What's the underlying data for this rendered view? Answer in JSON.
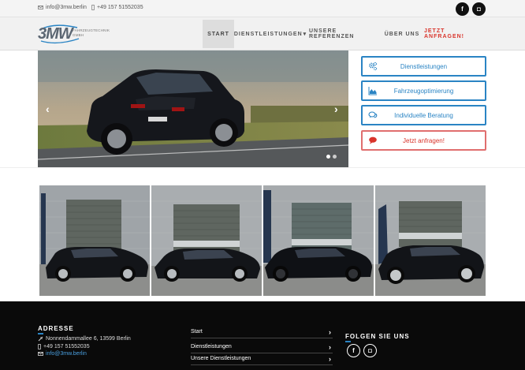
{
  "topbar": {
    "email": "info@3mw.berlin",
    "phone": "+49 157 51552035",
    "social_facebook": "f",
    "social_instagram": "◘"
  },
  "logo": {
    "main": "3MW",
    "sub_line1": "FAHRZEUGTECHNIK",
    "sub_line2": "GMBH"
  },
  "nav": {
    "items": [
      {
        "label": "START"
      },
      {
        "label": "DIENSTLEISTUNGEN"
      },
      {
        "label": "UNSERE REFERENZEN"
      },
      {
        "label": "ÜBER UNS"
      },
      {
        "label": "JETZT ANFRAGEN!"
      }
    ],
    "dropdown_caret": "▾"
  },
  "hero": {
    "prev": "‹",
    "next": "›",
    "slides_total": 2,
    "slide_active": 1
  },
  "side_buttons": [
    {
      "label": "Dienstleistungen",
      "icon": "gears-icon"
    },
    {
      "label": "Fahrzeugoptimierung",
      "icon": "area-chart-icon"
    },
    {
      "label": "Individuelle Beratung",
      "icon": "chat-bubbles-icon"
    },
    {
      "label": "Jetzt anfragen!",
      "icon": "comment-icon"
    }
  ],
  "footer": {
    "address_title": "ADRESSE",
    "address": "Nonnendammallee 6, 13599 Berlin",
    "phone": "+49 157 51552035",
    "email": "info@3mw.berlin",
    "nav": [
      {
        "label": "Start"
      },
      {
        "label": "Dienstleistungen"
      },
      {
        "label": "Unsere Dienstleistungen"
      }
    ],
    "chevron": "›",
    "follow_title": "FOLGEN SIE UNS",
    "social_facebook": "f",
    "social_instagram": "◘"
  },
  "colors": {
    "accent": "#2a84c4",
    "cta": "#d9342b",
    "footer_bg": "#0a0a0a"
  }
}
